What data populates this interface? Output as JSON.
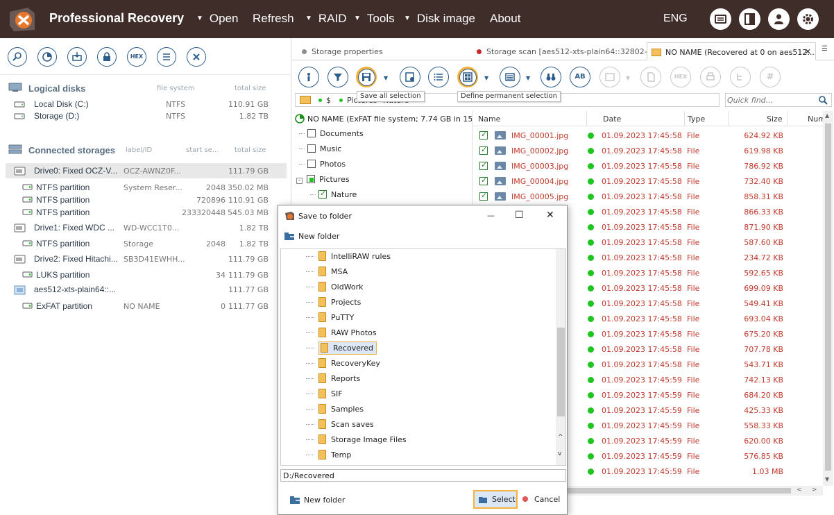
{
  "header": {
    "title": "Professional Recovery",
    "menu": [
      {
        "label": "Open",
        "arrow": true
      },
      {
        "label": "Refresh",
        "arrow": false
      },
      {
        "label": "RAID",
        "arrow": true
      },
      {
        "label": "Tools",
        "arrow": true
      },
      {
        "label": "Disk image",
        "arrow": true
      },
      {
        "label": "About",
        "arrow": false
      }
    ],
    "lang": "ENG",
    "menu_arrow": "▼"
  },
  "left": {
    "hex_label": "HEX",
    "logical": {
      "title": "Logical disks",
      "col_fs": "file system",
      "col_size": "total size",
      "items": [
        {
          "name": "Local Disk (C:)",
          "fs": "NTFS",
          "size": "110.91 GB"
        },
        {
          "name": "Storage (D:)",
          "fs": "NTFS",
          "size": "1.82 TB"
        }
      ]
    },
    "storages": {
      "title": "Connected storages",
      "col_label": "label/ID",
      "col_start": "start se...",
      "col_size": "total size",
      "items": [
        {
          "name": "Drive0: Fixed OCZ-V...",
          "label": "OCZ-AWNZ0F...",
          "start": "",
          "size": "111.79 GB",
          "level": 0,
          "selected": true
        },
        {
          "name": "NTFS partition",
          "label": "System Reser...",
          "start": "2048",
          "size": "350.02 MB",
          "level": 1
        },
        {
          "name": "NTFS partition",
          "label": "",
          "start": "720896",
          "size": "110.91 GB",
          "level": 1
        },
        {
          "name": "NTFS partition",
          "label": "",
          "start": "233320448",
          "size": "545.03 MB",
          "level": 1
        },
        {
          "name": "Drive1: Fixed WDC ...",
          "label": "WD-WCC1T0...",
          "start": "",
          "size": "1.82 TB",
          "level": 0
        },
        {
          "name": "NTFS partition",
          "label": "Storage",
          "start": "2048",
          "size": "1.82 TB",
          "level": 1
        },
        {
          "name": "Drive2: Fixed Hitachi...",
          "label": "SB3D41EWHH...",
          "start": "",
          "size": "111.79 GB",
          "level": 0
        },
        {
          "name": "LUKS partition",
          "label": "",
          "start": "34",
          "size": "111.79 GB",
          "level": 1
        },
        {
          "name": "aes512-xts-plain64::...",
          "label": "",
          "start": "",
          "size": "111.77 GB",
          "level": 0
        },
        {
          "name": "ExFAT partition",
          "label": "NO NAME",
          "start": "0",
          "size": "111.77 GB",
          "level": 1
        }
      ]
    }
  },
  "tabs": [
    {
      "label": "Storage properties",
      "dot": "#8c8c8c"
    },
    {
      "label": "Storage scan [aes512-xts-plain64::32802-...",
      "dot": "#c62828"
    },
    {
      "label": "NO NAME (Recovered at 0 on aes512...",
      "dot": ""
    }
  ],
  "toolbar": {
    "tooltip_save": "Save all selection",
    "tooltip_define": "Define permanent selection",
    "ab_label": "AB",
    "hex_label": "HEX",
    "hash_label": "#"
  },
  "pathbar": {
    "p1": "$",
    "p2": "Pictures",
    "p3": "Nature"
  },
  "search": {
    "placeholder": "Quick find..."
  },
  "tree": {
    "root": "NO NAME (ExFAT file system; 7.74 GB in 15567 ...",
    "items": [
      {
        "label": "Documents",
        "checked": false,
        "level": 1
      },
      {
        "label": "Music",
        "checked": false,
        "level": 1
      },
      {
        "label": "Photos",
        "checked": false,
        "level": 1
      },
      {
        "label": "Pictures",
        "checked": false,
        "level": 1,
        "expanded": true
      },
      {
        "label": "Nature",
        "checked": true,
        "level": 2
      }
    ]
  },
  "files": {
    "columns": {
      "name": "Name",
      "date": "Date",
      "type": "Type",
      "size": "Size",
      "num": "Num"
    },
    "rows": [
      {
        "name": "IMG_00001.jpg",
        "date": "01.09.2023 17:45:58",
        "type": "File",
        "size": "624.92 KB"
      },
      {
        "name": "IMG_00002.jpg",
        "date": "01.09.2023 17:45:58",
        "type": "File",
        "size": "619.98 KB"
      },
      {
        "name": "IMG_00003.jpg",
        "date": "01.09.2023 17:45:58",
        "type": "File",
        "size": "786.92 KB"
      },
      {
        "name": "IMG_00004.jpg",
        "date": "01.09.2023 17:45:58",
        "type": "File",
        "size": "732.40 KB"
      },
      {
        "name": "IMG_00005.jpg",
        "date": "01.09.2023 17:45:58",
        "type": "File",
        "size": "858.31 KB"
      },
      {
        "name": "",
        "date": "01.09.2023 17:45:58",
        "type": "File",
        "size": "866.33 KB"
      },
      {
        "name": "",
        "date": "01.09.2023 17:45:58",
        "type": "File",
        "size": "871.90 KB"
      },
      {
        "name": "",
        "date": "01.09.2023 17:45:58",
        "type": "File",
        "size": "587.60 KB"
      },
      {
        "name": "",
        "date": "01.09.2023 17:45:58",
        "type": "File",
        "size": "234.72 KB"
      },
      {
        "name": "",
        "date": "01.09.2023 17:45:58",
        "type": "File",
        "size": "592.65 KB"
      },
      {
        "name": "",
        "date": "01.09.2023 17:45:58",
        "type": "File",
        "size": "699.09 KB"
      },
      {
        "name": "",
        "date": "01.09.2023 17:45:58",
        "type": "File",
        "size": "549.41 KB"
      },
      {
        "name": "",
        "date": "01.09.2023 17:45:58",
        "type": "File",
        "size": "693.04 KB"
      },
      {
        "name": "",
        "date": "01.09.2023 17:45:58",
        "type": "File",
        "size": "675.20 KB"
      },
      {
        "name": "",
        "date": "01.09.2023 17:45:58",
        "type": "File",
        "size": "707.78 KB"
      },
      {
        "name": "",
        "date": "01.09.2023 17:45:58",
        "type": "File",
        "size": "543.71 KB"
      },
      {
        "name": "",
        "date": "01.09.2023 17:45:59",
        "type": "File",
        "size": "742.13 KB"
      },
      {
        "name": "",
        "date": "01.09.2023 17:45:59",
        "type": "File",
        "size": "684.20 KB"
      },
      {
        "name": "",
        "date": "01.09.2023 17:45:59",
        "type": "File",
        "size": "425.33 KB"
      },
      {
        "name": "",
        "date": "01.09.2023 17:45:59",
        "type": "File",
        "size": "558.33 KB"
      },
      {
        "name": "",
        "date": "01.09.2023 17:45:59",
        "type": "File",
        "size": "620.00 KB"
      },
      {
        "name": "",
        "date": "01.09.2023 17:45:59",
        "type": "File",
        "size": "576.85 KB"
      },
      {
        "name": "",
        "date": "01.09.2023 17:45:59",
        "type": "File",
        "size": "1.03 MB"
      }
    ]
  },
  "dialog": {
    "title": "Save to folder",
    "new_folder": "New folder",
    "folders": [
      "IntelliRAW rules",
      "MSA",
      "OldWork",
      "Projects",
      "PuTTY",
      "RAW Photos",
      "Recovered",
      "RecoveryKey",
      "Reports",
      "SIF",
      "Samples",
      "Scan saves",
      "Storage Image Files",
      "Temp"
    ],
    "selected": "Recovered",
    "path": "D:/Recovered",
    "select_label": "Select",
    "cancel_label": "Cancel",
    "min_glyph": "—",
    "max_glyph": "☐",
    "close_glyph": "✕"
  },
  "colors": {
    "titlebar": "#3f2d2a",
    "accent": "#f6b23e",
    "primary": "#2c5c8a",
    "file_text": "#c0392b",
    "ok": "#1fc41f"
  }
}
